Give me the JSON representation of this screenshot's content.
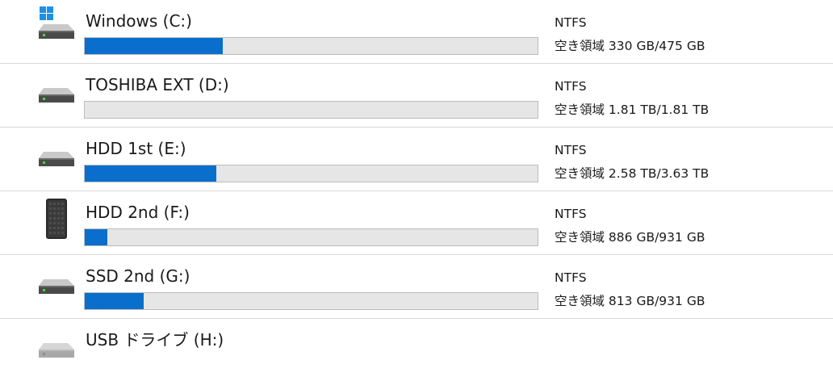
{
  "drives": [
    {
      "name": "Windows (C:)",
      "icon": "windows-system-drive-icon",
      "used_fraction": 0.305,
      "filesystem": "NTFS",
      "free_label": "空き領域 330 GB/475 GB"
    },
    {
      "name": "TOSHIBA EXT (D:)",
      "icon": "hard-drive-icon",
      "used_fraction": 0.0,
      "filesystem": "NTFS",
      "free_label": "空き領域 1.81 TB/1.81 TB"
    },
    {
      "name": "HDD 1st (E:)",
      "icon": "hard-drive-icon",
      "used_fraction": 0.29,
      "filesystem": "NTFS",
      "free_label": "空き領域 2.58 TB/3.63 TB"
    },
    {
      "name": "HDD 2nd (F:)",
      "icon": "external-hard-drive-icon",
      "used_fraction": 0.05,
      "filesystem": "NTFS",
      "free_label": "空き領域 886 GB/931 GB"
    },
    {
      "name": "SSD 2nd (G:)",
      "icon": "hard-drive-icon",
      "used_fraction": 0.13,
      "filesystem": "NTFS",
      "free_label": "空き領域 813 GB/931 GB"
    },
    {
      "name": "USB ドライブ (H:)",
      "icon": "usb-drive-icon",
      "used_fraction": null,
      "filesystem": "",
      "free_label": ""
    }
  ],
  "colors": {
    "bar_fill": "#0a6fcc",
    "bar_track": "#e6e6e6",
    "windows_logo": "#1e90e6"
  }
}
